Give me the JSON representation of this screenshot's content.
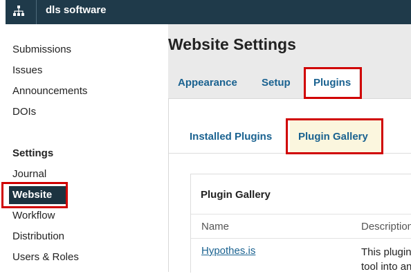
{
  "header": {
    "app_title": "dls software",
    "logo_icon": "sitemap-icon"
  },
  "sidebar": {
    "items": [
      {
        "label": "Submissions"
      },
      {
        "label": "Issues"
      },
      {
        "label": "Announcements"
      },
      {
        "label": "DOIs"
      }
    ],
    "settings_heading": "Settings",
    "settings_items": [
      {
        "label": "Journal"
      },
      {
        "label": "Website",
        "active": true
      },
      {
        "label": "Workflow"
      },
      {
        "label": "Distribution"
      },
      {
        "label": "Users & Roles"
      }
    ]
  },
  "main": {
    "page_title": "Website Settings",
    "tabs": [
      {
        "label": "Appearance"
      },
      {
        "label": "Setup"
      },
      {
        "label": "Plugins",
        "active": true
      }
    ],
    "subtabs": [
      {
        "label": "Installed Plugins"
      },
      {
        "label": "Plugin Gallery",
        "active": true
      }
    ],
    "gallery": {
      "title": "Plugin Gallery",
      "columns": [
        "Name",
        "Description"
      ],
      "rows": [
        {
          "name": "Hypothes.is",
          "description_line1": "This plugin",
          "description_line2": "tool into an"
        }
      ]
    }
  },
  "colors": {
    "topbar": "#1f3a4a",
    "active_nav": "#1c3340",
    "highlight": "#d00000",
    "link": "#1a6290"
  }
}
